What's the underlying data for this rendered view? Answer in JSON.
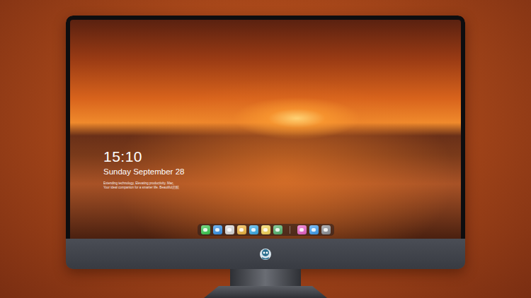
{
  "lock_screen": {
    "time": "15:10",
    "date": "Sunday September 28",
    "tagline": [
      "Extending technology, Elevating productivity. Mac,",
      "Your ideal companion for a smarter life. Beautiful启航"
    ]
  },
  "dock": {
    "apps": [
      {
        "color": "#35c84a"
      },
      {
        "color": "#2f8fe8"
      },
      {
        "color": "#d9d9d9"
      },
      {
        "color": "#f0b43a"
      },
      {
        "color": "#35a9e6"
      },
      {
        "color": "#f5d451"
      },
      {
        "color": "#4fb36a"
      }
    ],
    "recent": [
      {
        "color": "#e85ec8"
      },
      {
        "color": "#3a9cf0"
      },
      {
        "color": "#8a8d93"
      }
    ]
  }
}
